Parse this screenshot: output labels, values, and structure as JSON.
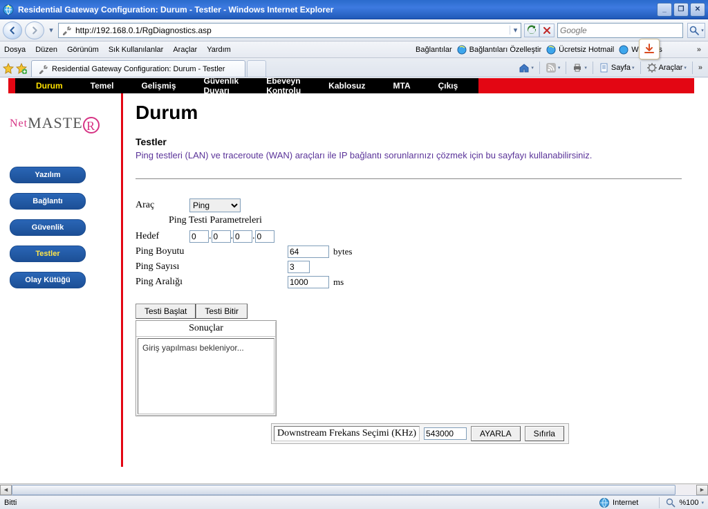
{
  "window": {
    "title": "Residential Gateway Configuration: Durum - Testler - Windows Internet Explorer"
  },
  "address": {
    "url": "http://192.168.0.1/RgDiagnostics.asp"
  },
  "search": {
    "placeholder": "Google"
  },
  "menu": {
    "items": [
      "Dosya",
      "Düzen",
      "Görünüm",
      "Sık Kullanılanlar",
      "Araçlar",
      "Yardım"
    ],
    "links": {
      "baglantilar": "Bağlantılar",
      "ozel": "Bağlantıları Özelleştir",
      "hotmail": "Ücretsiz Hotmail",
      "windows": "Windows"
    }
  },
  "tab": {
    "label": "Residential Gateway Configuration: Durum - Testler"
  },
  "cmdbar": {
    "page": "Sayfa",
    "tools": "Araçlar"
  },
  "router": {
    "nav": {
      "durum": "Durum",
      "temel": "Temel",
      "gelismis": "Gelişmiş",
      "guvenlik": "Güvenlik Duvarı",
      "ebeveyn": "Ebeveyn Kontrolu",
      "kablosuz": "Kablosuz",
      "mta": "MTA",
      "cikis": "Çıkış"
    },
    "brand": {
      "net": "Net",
      "master": "MASTE",
      "r": "R"
    },
    "side": {
      "yazilim": "Yazılım",
      "baglanti": "Bağlantı",
      "guvenlik": "Güvenlik",
      "testler": "Testler",
      "olay": "Olay Kütüğü"
    },
    "page": {
      "h1": "Durum",
      "h2": "Testler",
      "descr": "Ping testleri (LAN) ve traceroute (WAN) araçları ile IP bağlantı sorunlarınızı çözmek için bu sayfayı kullanabilirsiniz."
    },
    "form": {
      "tool_label": "Araç",
      "tool_selected": "Ping",
      "section_title": "Ping Testi Parametreleri",
      "target_label": "Hedef",
      "ip": {
        "a": "0",
        "b": "0",
        "c": "0",
        "d": "0"
      },
      "size_label": "Ping Boyutu",
      "size_value": "64",
      "size_unit": "bytes",
      "count_label": "Ping Sayısı",
      "count_value": "3",
      "interval_label": "Ping Aralığı",
      "interval_value": "1000",
      "interval_unit": "ms",
      "start": "Testi Başlat",
      "stop": "Testi Bitir",
      "results_head": "Sonuçlar",
      "results_body": "Giriş yapılması bekleniyor...",
      "freq_label": "Downstream Frekans Seçimi (KHz)",
      "freq_value": "543000",
      "apply": "AYARLA",
      "reset": "Sıfırla"
    }
  },
  "status": {
    "ready": "Bitti",
    "zone": "Internet",
    "zoom": "%100"
  }
}
